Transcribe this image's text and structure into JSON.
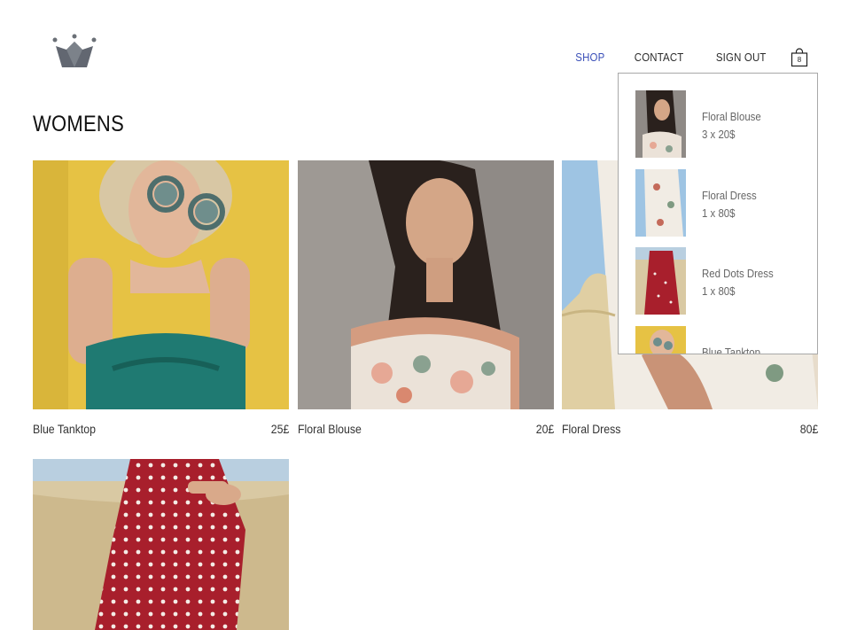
{
  "nav": {
    "items": [
      {
        "label": "SHOP",
        "active": true
      },
      {
        "label": "CONTACT",
        "active": false
      },
      {
        "label": "SIGN OUT",
        "active": false
      }
    ],
    "cart_count": "8"
  },
  "page_title": "WOMENS",
  "products": [
    {
      "name": "Blue Tanktop",
      "price": "25£"
    },
    {
      "name": "Floral Blouse",
      "price": "20£"
    },
    {
      "name": "Floral Dress",
      "price": "80£"
    },
    {
      "name": "",
      "price": ""
    }
  ],
  "cart_items": [
    {
      "name": "Floral Blouse",
      "qty": "3 x 20$"
    },
    {
      "name": "Floral Dress",
      "qty": "1 x 80$"
    },
    {
      "name": "Red Dots Dress",
      "qty": "1 x 80$"
    },
    {
      "name": "Blue Tanktop",
      "qty": ""
    }
  ],
  "colors": {
    "accent": "#3a4fb8",
    "text": "#333333",
    "muted": "#666666",
    "border": "#a8a8a8"
  },
  "icons": {
    "logo": "crown-icon",
    "cart": "shopping-bag-icon"
  }
}
